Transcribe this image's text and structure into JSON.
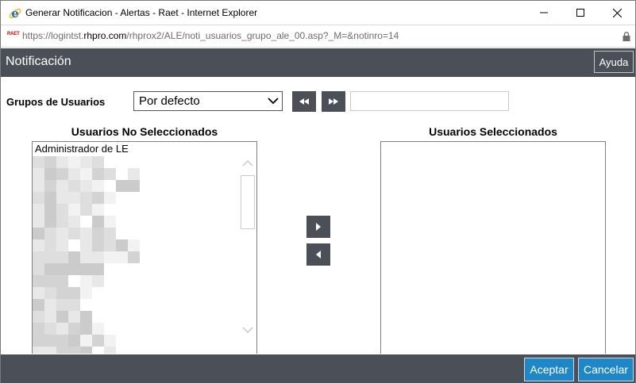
{
  "window": {
    "title": "Generar Notificacion - Alertas - Raet - Internet Explorer",
    "url_prefix": "https://logintst.",
    "url_host": "rhpro.com",
    "url_path": "/rhprox2/ALE/noti_usuarios_grupo_ale_00.asp?_M=&notinro=14",
    "favicon_text": "RAET"
  },
  "header": {
    "title": "Notificación",
    "help_label": "Ayuda"
  },
  "groups": {
    "label": "Grupos de Usuarios",
    "selected": "Por defecto",
    "search_value": ""
  },
  "lists": {
    "unselected_title": "Usuarios No Seleccionados",
    "selected_title": "Usuarios Seleccionados",
    "unselected_items": [
      "Administrador de LE"
    ],
    "selected_items": []
  },
  "footer": {
    "accept_label": "Aceptar",
    "cancel_label": "Cancelar"
  },
  "colors": {
    "bar": "#4b4f58",
    "primary_button": "#1f87c6"
  },
  "icons": {
    "browser": "internet-explorer-icon",
    "minimize": "minimize-icon",
    "maximize": "maximize-icon",
    "close": "close-icon",
    "lock": "lock-icon",
    "dropdown": "chevron-down-icon",
    "prev_group": "double-arrow-left-icon",
    "next_group": "double-arrow-right-icon",
    "add": "arrow-right-icon",
    "remove": "arrow-left-icon"
  }
}
